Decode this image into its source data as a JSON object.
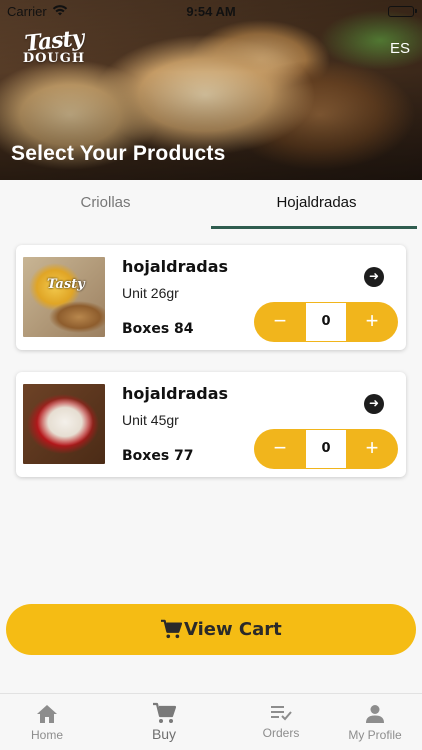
{
  "status_bar": {
    "carrier": "Carrier",
    "time": "9:54 AM"
  },
  "header": {
    "logo_line1": "Tasty",
    "logo_line2": "DOUGH",
    "language": "ES",
    "title": "Select Your Products"
  },
  "tabs": [
    {
      "label": "Criollas",
      "active": false
    },
    {
      "label": "Hojaldradas",
      "active": true
    }
  ],
  "products": [
    {
      "name": "hojaldradas",
      "unit": "Unit 26gr",
      "boxes": "Boxes 84",
      "quantity": "0"
    },
    {
      "name": "hojaldradas",
      "unit": "Unit 45gr",
      "boxes": "Boxes 77",
      "quantity": "0"
    }
  ],
  "stepper": {
    "minus": "−",
    "plus": "+"
  },
  "cart": {
    "label": "View Cart"
  },
  "nav": {
    "home": "Home",
    "buy": "Buy",
    "orders": "Orders",
    "profile": "My Profile"
  },
  "colors": {
    "accent": "#f5bc14",
    "stepper": "#f1b51c",
    "tab_indicator": "#2f5d4f",
    "nav_inactive": "#8d8d8d"
  }
}
